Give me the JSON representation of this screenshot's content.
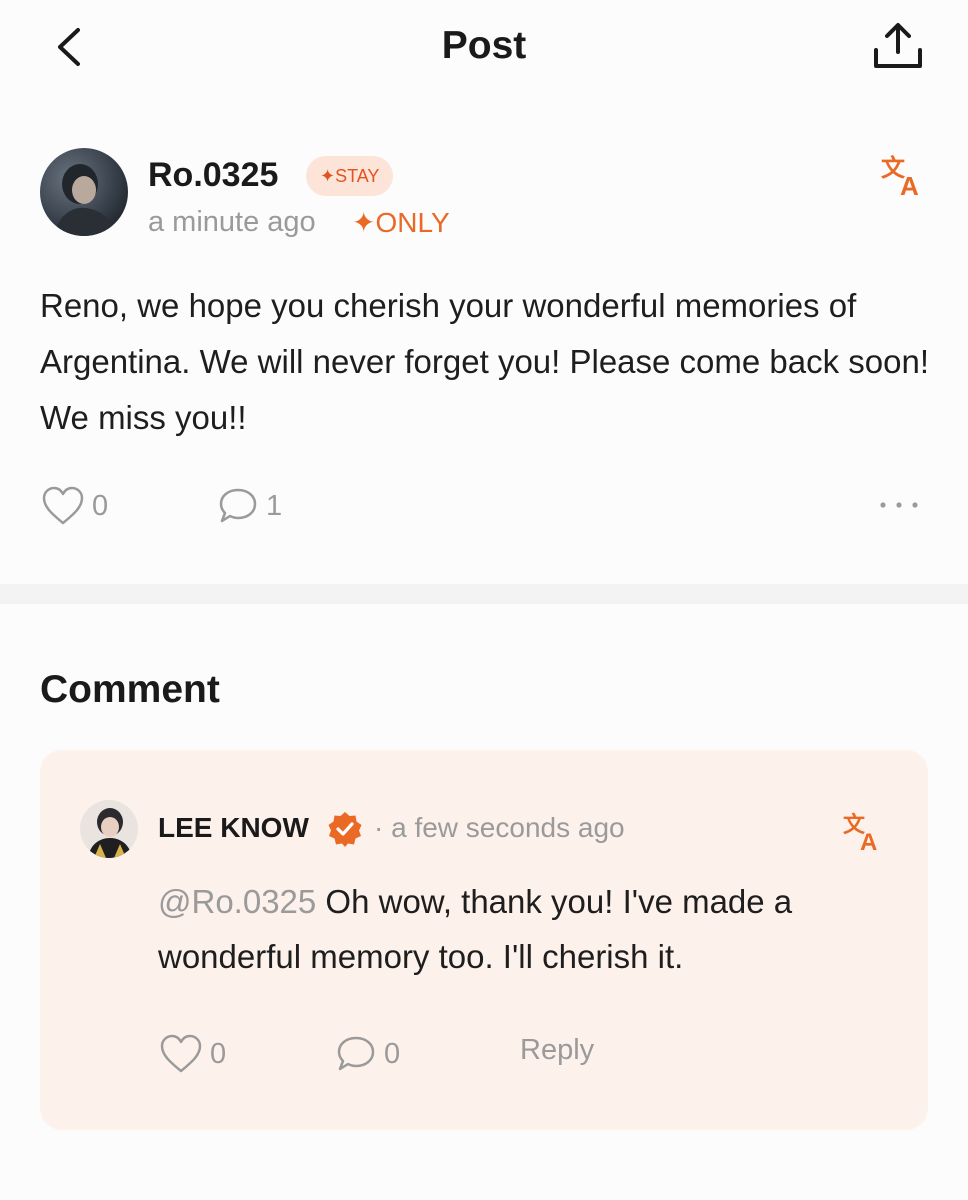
{
  "header": {
    "title": "Post"
  },
  "post": {
    "username": "Ro.0325",
    "badge": "✦STAY",
    "time": "a minute ago",
    "visibility": "✦ONLY",
    "body": "Reno, we hope you cherish your wonderful memories of Argentina. We will never forget you! Please come back soon! We miss you!!",
    "likes": "0",
    "comments": "1"
  },
  "comments_section": {
    "heading": "Comment",
    "items": [
      {
        "author": "LEE KNOW",
        "separator_time": "· a few seconds ago",
        "mention": "@Ro.0325",
        "text": " Oh wow, thank you! I've made a wonderful memory too. I'll cherish it.",
        "likes": "0",
        "replies": "0",
        "reply_label": "Reply"
      }
    ]
  },
  "colors": {
    "accent": "#ea6a25",
    "badge_bg": "#fde4d8",
    "card_bg": "#fdf1ec",
    "muted": "#9a9a9a"
  },
  "icons": [
    "back-arrow-icon",
    "share-icon",
    "translate-icon",
    "heart-icon",
    "comment-bubble-icon",
    "more-icon",
    "verified-badge-icon"
  ]
}
